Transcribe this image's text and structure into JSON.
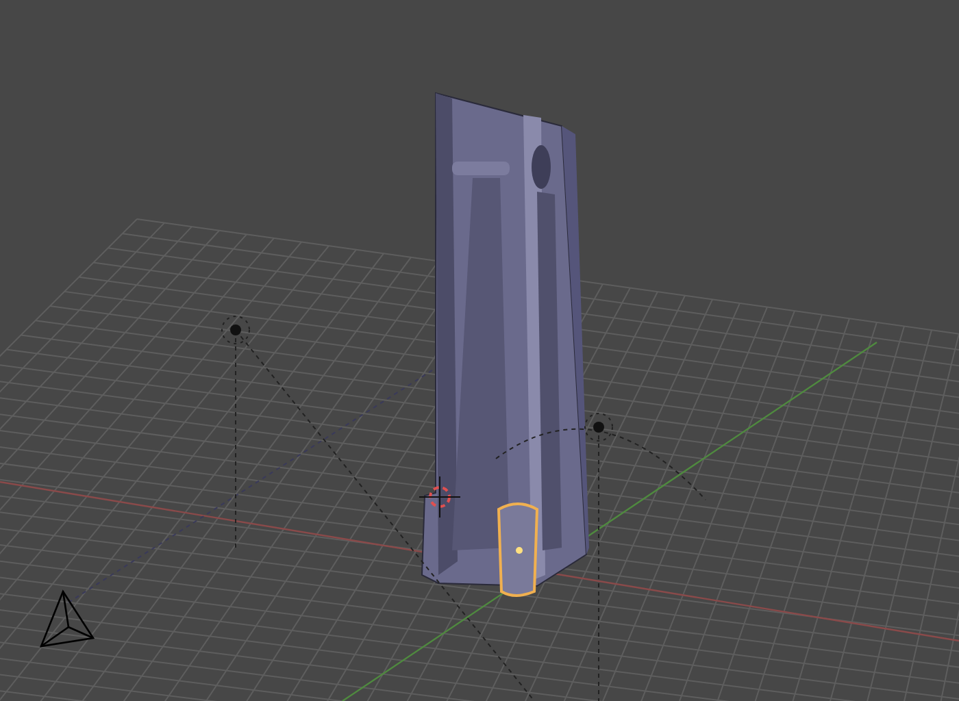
{
  "viewport": {
    "objects": [
      {
        "kind": "mesh",
        "selected": false
      },
      {
        "kind": "part",
        "selected": true
      },
      {
        "kind": "lamp",
        "selected": false
      },
      {
        "kind": "lamp",
        "selected": false
      },
      {
        "kind": "cursor",
        "selected": false
      },
      {
        "kind": "gizmo",
        "selected": false
      }
    ]
  }
}
